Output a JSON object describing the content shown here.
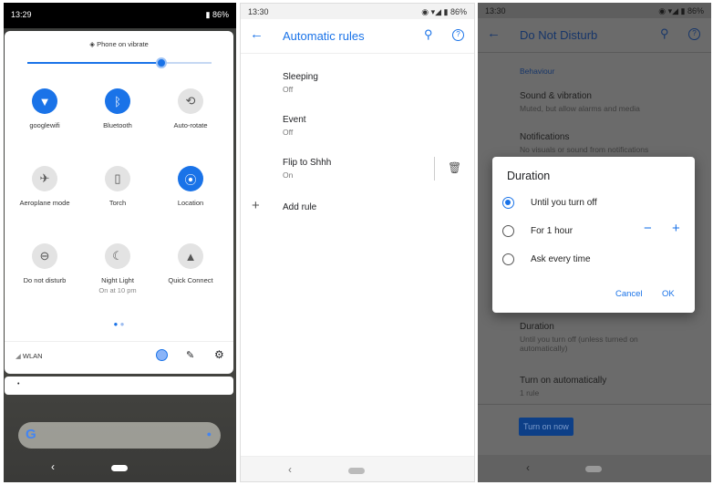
{
  "quick_settings": {
    "status_time": "13:29",
    "battery": "86%",
    "vibrate_label": "Phone on vibrate",
    "brightness_level": 0.73,
    "tiles": [
      {
        "label": "googlewifi",
        "icon": "wifi-icon",
        "on": true
      },
      {
        "label": "Bluetooth",
        "icon": "bluetooth-icon",
        "on": true
      },
      {
        "label": "Auto-rotate",
        "icon": "rotate-icon",
        "on": false
      },
      {
        "label": "Aeroplane mode",
        "icon": "airplane-icon",
        "on": false
      },
      {
        "label": "Torch",
        "icon": "torch-icon",
        "on": false
      },
      {
        "label": "Location",
        "icon": "location-icon",
        "on": true
      },
      {
        "label": "Do not disturb",
        "icon": "dnd-icon",
        "on": false
      },
      {
        "label": "Night Light",
        "sub": "On at 10 pm",
        "icon": "moon-icon",
        "on": false
      },
      {
        "label": "Quick Connect",
        "icon": "quick-connect-icon",
        "on": false
      }
    ],
    "network_label": "WLAN",
    "notification_text": "•"
  },
  "automatic_rules": {
    "status_time": "13:30",
    "battery": "86%",
    "title": "Automatic rules",
    "rules": [
      {
        "name": "Sleeping",
        "state": "Off"
      },
      {
        "name": "Event",
        "state": "Off"
      },
      {
        "name": "Flip to Shhh",
        "state": "On"
      }
    ],
    "add_rule": "Add rule"
  },
  "do_not_disturb": {
    "status_time": "13:30",
    "battery": "86%",
    "title": "Do Not Disturb",
    "section": "Behaviour",
    "items": [
      {
        "title": "Sound & vibration",
        "sub": "Muted, but allow alarms and media"
      },
      {
        "title": "Notifications",
        "sub": "No visuals or sound from notifications"
      },
      {
        "title": "Duration",
        "sub": "Until you turn off (unless turned on automatically)"
      },
      {
        "title": "Turn on automatically",
        "sub": "1 rule"
      }
    ],
    "turn_on_now": "Turn on now",
    "dialog": {
      "title": "Duration",
      "options": [
        "Until you turn off",
        "For 1 hour",
        "Ask every time"
      ],
      "selected": 0,
      "minus": "−",
      "plus": "+",
      "cancel": "Cancel",
      "ok": "OK"
    }
  },
  "colors": {
    "accent": "#1a73e8"
  }
}
